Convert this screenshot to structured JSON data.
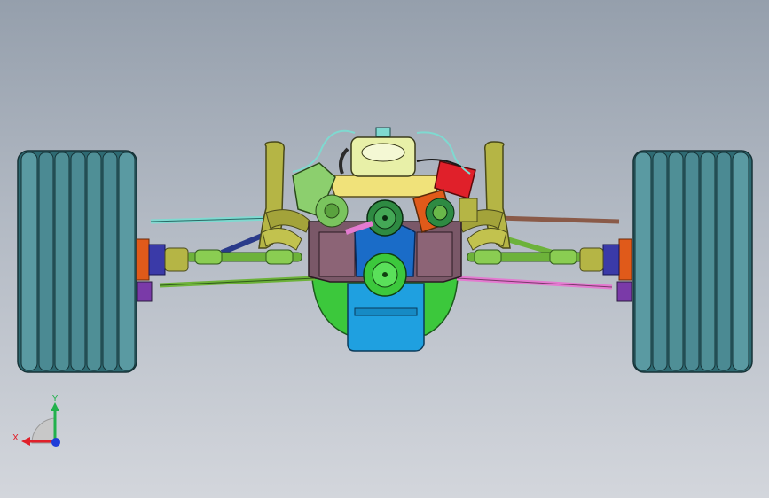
{
  "viewport": {
    "background_top": "#959fac",
    "background_bottom": "#d3d6dc"
  },
  "triad": {
    "x_label": "X",
    "y_label": "Y",
    "x_color": "#e0202a",
    "y_color": "#22b14c",
    "z_color": "#1e3cd8"
  },
  "model": {
    "tire_color": "#4f8f96",
    "engine_block_color": "#7a5868",
    "oil_pan_color": "#1fa0e0",
    "bellhousing_color": "#3cc83c",
    "header_color": "#b5b545",
    "alternator_color": "#8ccf6e",
    "coil_color": "#e0202a",
    "hub_color": "#e05a1a",
    "link_green_color": "#6db23a",
    "link_pink_color": "#e37ad0",
    "link_cyan_color": "#7fd9d0",
    "link_navy_color": "#2a3a8a",
    "link_brown_color": "#8a5a48"
  }
}
